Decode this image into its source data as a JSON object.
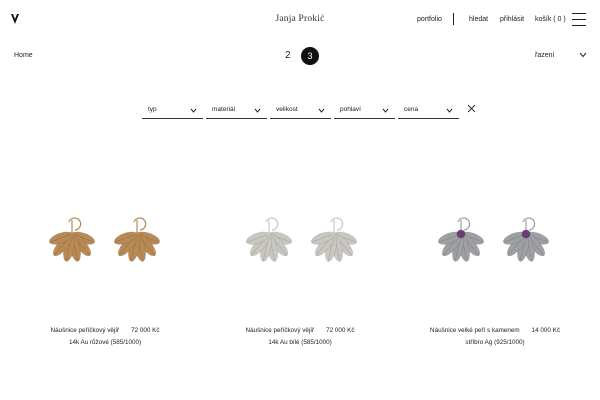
{
  "header": {
    "brand": "Janja Prokić",
    "nav": [
      "portfolio",
      "hledat",
      "přihlásit",
      "košík ( 0 )"
    ]
  },
  "breadcrumb": "Home",
  "pagination": {
    "previous": "2",
    "current": "3"
  },
  "sort_label": "řazení",
  "filters": [
    "typ",
    "materiál",
    "velikost",
    "pohlaví",
    "cena"
  ],
  "products": [
    {
      "name": "Náušnice peříčkový vějíř",
      "price": "72 000 Kč",
      "material": "14k Au růžové (585/1000)",
      "color": "#b98a55"
    },
    {
      "name": "Náušnice peříčkový vějíř",
      "price": "72 000 Kč",
      "material": "14k Au bílé (585/1000)",
      "color": "#c9c7c1"
    },
    {
      "name": "Náušnice velké peří s kamenem",
      "price": "14 000 Kč",
      "material": "stříbro Ag (925/1000)",
      "color": "#9ea0a4",
      "stone": "#6b3a7a"
    }
  ]
}
